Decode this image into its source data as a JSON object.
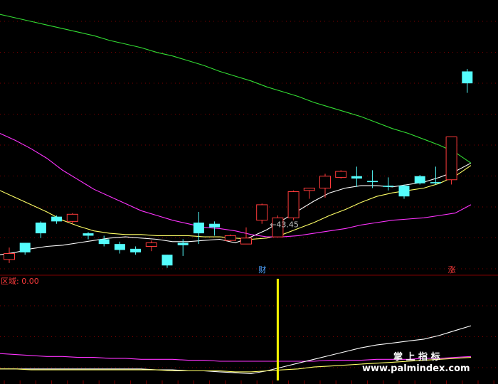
{
  "chart_data": [
    {
      "type": "candlestick",
      "low_marker": "←43.45",
      "event_badges": [
        {
          "label": "财",
          "candle_index": 16,
          "color": "#4da3ff"
        },
        {
          "label": "涨",
          "candle_index": 28,
          "color": "#ff3b3b"
        }
      ],
      "colors": {
        "up": "#ff3b3b",
        "down": "#54fcfc",
        "background": "#000000",
        "grid": "#7f0000"
      },
      "candles": [
        {
          "o": 0.67,
          "c": 0.72,
          "h": 0.77,
          "l": 0.64
        },
        {
          "o": 0.81,
          "c": 0.73,
          "h": 0.81,
          "l": 0.71
        },
        {
          "o": 0.98,
          "c": 0.89,
          "h": 0.99,
          "l": 0.85
        },
        {
          "o": 1.03,
          "c": 0.99,
          "h": 1.04,
          "l": 0.97
        },
        {
          "o": 0.99,
          "c": 1.05,
          "h": 1.06,
          "l": 0.97
        },
        {
          "o": 0.89,
          "c": 0.87,
          "h": 0.9,
          "l": 0.84
        },
        {
          "o": 0.84,
          "c": 0.8,
          "h": 0.87,
          "l": 0.78
        },
        {
          "o": 0.8,
          "c": 0.75,
          "h": 0.82,
          "l": 0.72
        },
        {
          "o": 0.76,
          "c": 0.73,
          "h": 0.78,
          "l": 0.71
        },
        {
          "o": 0.78,
          "c": 0.81,
          "h": 0.83,
          "l": 0.74
        },
        {
          "o": 0.71,
          "c": 0.62,
          "h": 0.71,
          "l": 0.6
        },
        {
          "o": 0.81,
          "c": 0.79,
          "h": 0.84,
          "l": 0.7
        },
        {
          "o": 0.98,
          "c": 0.89,
          "h": 1.07,
          "l": 0.8
        },
        {
          "o": 0.97,
          "c": 0.94,
          "h": 0.99,
          "l": 0.87
        },
        {
          "o": 0.83,
          "c": 0.87,
          "h": 0.88,
          "l": 0.82
        },
        {
          "o": 0.8,
          "c": 0.85,
          "h": 0.94,
          "l": 0.85
        },
        {
          "o": 1.0,
          "c": 1.13,
          "h": 1.14,
          "l": 0.97
        },
        {
          "o": 0.86,
          "c": 1.02,
          "h": 1.04,
          "l": 0.86
        },
        {
          "o": 1.02,
          "c": 1.24,
          "h": 1.25,
          "l": 1.0
        },
        {
          "o": 1.25,
          "c": 1.27,
          "h": 1.27,
          "l": 1.18
        },
        {
          "o": 1.27,
          "c": 1.37,
          "h": 1.39,
          "l": 1.19
        },
        {
          "o": 1.36,
          "c": 1.41,
          "h": 1.42,
          "l": 1.35
        },
        {
          "o": 1.37,
          "c": 1.35,
          "h": 1.45,
          "l": 1.28
        },
        {
          "o": 1.33,
          "c": 1.32,
          "h": 1.42,
          "l": 1.27
        },
        {
          "o": 1.29,
          "c": 1.28,
          "h": 1.36,
          "l": 1.25
        },
        {
          "o": 1.29,
          "c": 1.2,
          "h": 1.3,
          "l": 1.18
        },
        {
          "o": 1.37,
          "c": 1.31,
          "h": 1.38,
          "l": 1.3
        },
        {
          "o": 1.32,
          "c": 1.31,
          "h": 1.45,
          "l": 1.3
        },
        {
          "o": 1.34,
          "c": 1.7,
          "h": 1.7,
          "l": 1.3
        },
        {
          "o": 2.25,
          "c": 2.15,
          "h": 2.27,
          "l": 2.07
        }
      ],
      "series": [
        {
          "color": "#ffffff",
          "values": [
            0.71,
            0.73,
            0.76,
            0.78,
            0.79,
            0.81,
            0.83,
            0.85,
            0.86,
            0.85,
            0.84,
            0.82,
            0.82,
            0.83,
            0.84,
            0.81,
            0.86,
            0.92,
            1.0,
            1.08,
            1.16,
            1.23,
            1.27,
            1.29,
            1.29,
            1.28,
            1.3,
            1.32,
            1.36,
            1.41,
            1.48
          ]
        },
        {
          "color": "#ffff66",
          "values": [
            1.25,
            1.19,
            1.13,
            1.07,
            1.0,
            0.95,
            0.91,
            0.89,
            0.88,
            0.88,
            0.87,
            0.87,
            0.87,
            0.86,
            0.86,
            0.85,
            0.84,
            0.85,
            0.88,
            0.93,
            0.98,
            1.04,
            1.09,
            1.15,
            1.2,
            1.23,
            1.25,
            1.27,
            1.31,
            1.37,
            1.46
          ]
        },
        {
          "color": "#ff33ff",
          "values": [
            1.73,
            1.67,
            1.6,
            1.52,
            1.42,
            1.34,
            1.26,
            1.2,
            1.14,
            1.08,
            1.04,
            1.0,
            0.97,
            0.94,
            0.93,
            0.91,
            0.88,
            0.86,
            0.86,
            0.87,
            0.89,
            0.91,
            0.93,
            0.96,
            0.98,
            1.0,
            1.01,
            1.02,
            1.04,
            1.06,
            1.13
          ]
        },
        {
          "color": "#33dd33",
          "values": [
            2.73,
            2.7,
            2.67,
            2.64,
            2.61,
            2.58,
            2.55,
            2.51,
            2.48,
            2.45,
            2.41,
            2.38,
            2.34,
            2.3,
            2.25,
            2.21,
            2.17,
            2.12,
            2.08,
            2.04,
            1.99,
            1.95,
            1.91,
            1.87,
            1.82,
            1.77,
            1.73,
            1.68,
            1.63,
            1.57,
            1.48
          ]
        }
      ],
      "ylim": [
        0.55,
        2.85
      ]
    },
    {
      "type": "line",
      "label": "区域: 0.00",
      "watermark": {
        "title": "掌 上 指 标",
        "url": "www.palmindex.com"
      },
      "signal_bar": {
        "candle_index": 17,
        "color": "#ffff00",
        "value": 1.0
      },
      "series": [
        {
          "color": "#ff33ff",
          "values": [
            0.28,
            0.27,
            0.26,
            0.25,
            0.25,
            0.24,
            0.24,
            0.23,
            0.23,
            0.22,
            0.22,
            0.22,
            0.21,
            0.21,
            0.2,
            0.2,
            0.2,
            0.2,
            0.2,
            0.2,
            0.2,
            0.21,
            0.21,
            0.21,
            0.22,
            0.22,
            0.22,
            0.23,
            0.23,
            0.24,
            0.25
          ]
        },
        {
          "color": "#ffffff",
          "values": [
            0.12,
            0.12,
            0.12,
            0.12,
            0.12,
            0.12,
            0.12,
            0.12,
            0.12,
            0.12,
            0.11,
            0.11,
            0.1,
            0.1,
            0.09,
            0.08,
            0.07,
            0.1,
            0.14,
            0.18,
            0.22,
            0.26,
            0.3,
            0.34,
            0.37,
            0.39,
            0.41,
            0.43,
            0.47,
            0.52,
            0.57
          ]
        },
        {
          "color": "#ffff66",
          "values": [
            0.12,
            0.12,
            0.11,
            0.11,
            0.11,
            0.11,
            0.11,
            0.11,
            0.11,
            0.11,
            0.11,
            0.1,
            0.1,
            0.1,
            0.1,
            0.09,
            0.09,
            0.1,
            0.11,
            0.12,
            0.14,
            0.15,
            0.16,
            0.17,
            0.18,
            0.19,
            0.2,
            0.21,
            0.22,
            0.23,
            0.24
          ]
        }
      ],
      "ylim": [
        0.0,
        1.0
      ]
    }
  ]
}
